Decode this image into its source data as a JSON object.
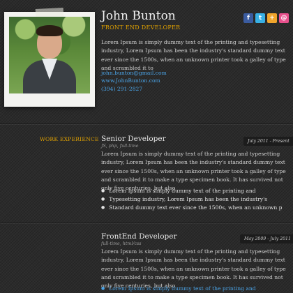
{
  "profile": {
    "name": "John Bunton",
    "role": "FRONT END DEVELOPER",
    "intro": "Lorem Ipsum is simply dummy text of the printing and typesetting industry, Lorem Ipsum has been the industry's standard dummy text ever since the 1500s, when an unknown printer took a galley of type and scrambled it to",
    "email": "john.bunton@gmail.com",
    "website": "www.JohnBunton.com",
    "phone": "(394) 291-2827"
  },
  "social": {
    "facebook": "f",
    "twitter": "t",
    "delicious": "+",
    "dribbble": "@",
    "icons": [
      "facebook-icon",
      "twitter-icon",
      "delicious-icon",
      "dribbble-icon"
    ],
    "colors": {
      "facebook": "#3b5ca0",
      "twitter": "#38b0e4",
      "delicious": "#f0a52c",
      "dribbble": "#e8508c"
    }
  },
  "work_experience": {
    "label": "WORK EXPERIENCE",
    "jobs": [
      {
        "title": "Senior Developer",
        "tags": "JS, php, full-time",
        "dates": "July 2011 - Present",
        "description": "Lorem Ipsum is simply dummy text of the printing and typesetting industry, Lorem Ipsum has been the industry's standard dummy text ever since the 1500s, when an unknown printer took a galley of type and scrambled it to make a type specimen book. It has survived not only five centuries, but also",
        "bullets": [
          "Lorem Ipsum is simply dummy text of the printing and",
          "Typesetting industry, Lorem Ipsum has been the industry's",
          "Standard dummy text ever since the 1500s, when an unknown p"
        ]
      },
      {
        "title": "FrontEnd Developer",
        "tags": "full-time, html/css",
        "dates": "May 2009 - July 2011",
        "description": "Lorem Ipsum is simply dummy text of the printing and typesetting industry, Lorem Ipsum has been the industry's standard dummy text ever since the 1500s, when an unknown printer took a galley of type and scrambled it to make a type specimen book. It has survived not only five centuries, but also",
        "bullets": [
          "Lorem Ipsum is simply dummy text of the printing and"
        ]
      }
    ]
  },
  "colors": {
    "accent": "#e0a100",
    "link": "#4aa3e6",
    "background": "#2b2b2b"
  }
}
